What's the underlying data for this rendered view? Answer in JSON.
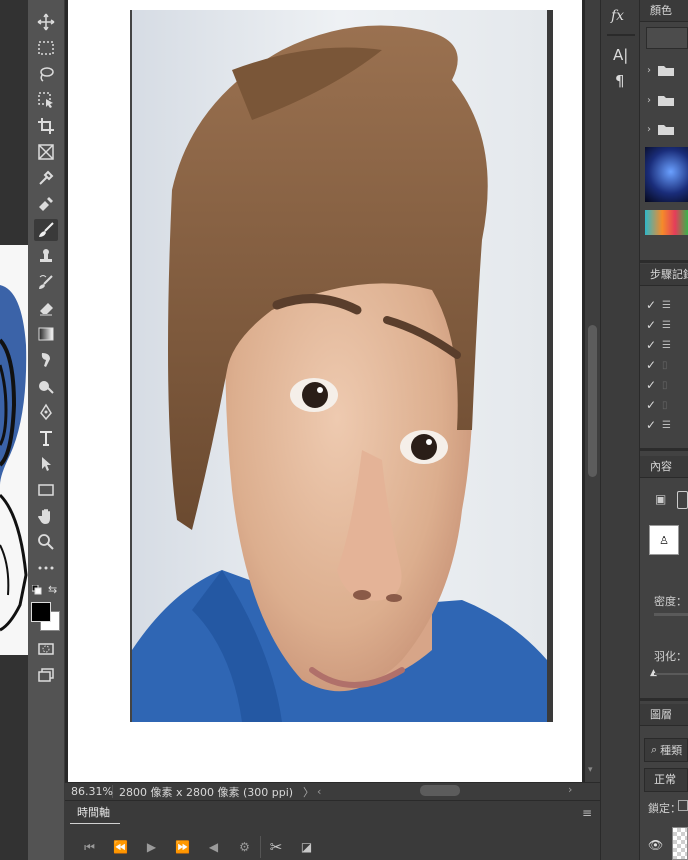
{
  "canvas": {
    "zoom": "86.31%",
    "doc_info": "2800 像素 x 2800 像素 (300 ppi)",
    "doc_info_arrow": "〉",
    "scroll_left_arrow": "‹",
    "scroll_right_arrow": "›"
  },
  "timeline": {
    "tab_label": "時間軸",
    "menu_icon": "≡"
  },
  "tools": [
    "move-tool",
    "marquee-tool",
    "lasso-tool",
    "object-select-tool",
    "crop-tool",
    "frame-tool",
    "eyedropper-tool",
    "healing-brush-tool",
    "brush-tool",
    "clone-stamp-tool",
    "history-brush-tool",
    "eraser-tool",
    "gradient-tool",
    "smudge-tool",
    "dodge-tool",
    "pen-tool",
    "type-tool",
    "path-select-tool",
    "rectangle-tool",
    "hand-tool",
    "zoom-tool",
    "more-tools",
    "swap-colors-icon",
    "foreground-color",
    "quick-mask-tool",
    "screen-mode-tool"
  ],
  "propstrip": {
    "fx_label": "fx",
    "char_label": "A|",
    "para_label": "¶"
  },
  "right_panel": {
    "color_tab": "顏色",
    "history_tab": "步驟記錄",
    "properties_tab": "內容",
    "layers_tab": "圖層",
    "density_label": "密度：",
    "feather_label": "羽化：",
    "kind_label": "種類",
    "blend_mode": "正常",
    "lock_label": "鎖定："
  },
  "colors": {
    "panel_bg": "#424242",
    "toolbar_bg": "#535353",
    "canvas_bg": "#ffffff",
    "accent": "#3a6ea5"
  }
}
